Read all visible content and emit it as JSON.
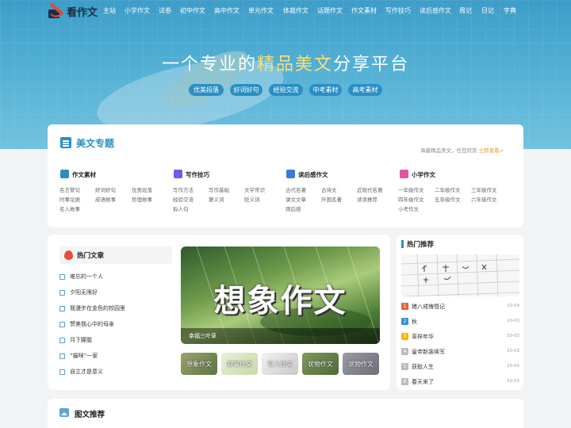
{
  "nav": {
    "logo_text": "看作文",
    "items": [
      "主站",
      "小学作文",
      "试卷",
      "初中作文",
      "高中作文",
      "单元作文",
      "体裁作文",
      "话题作文",
      "作文素材",
      "写作技巧",
      "读后感作文",
      "周记",
      "日记",
      "字典"
    ]
  },
  "hero": {
    "title_pre": "一个专业的",
    "title_highlight": "精品美文",
    "title_post": "分享平台",
    "tags": [
      "优美段落",
      "好词好句",
      "经验交流",
      "中考素材",
      "高考素材"
    ]
  },
  "topics": {
    "title": "美文专题",
    "slogan": "海量精品美文，任您欣赏",
    "more": "立即查看>",
    "columns": [
      {
        "title": "作文素材",
        "icon": "document-icon",
        "color": "#2a8fc4",
        "links": [
          "名言警句",
          "好词好句",
          "优美段落",
          "时事论据",
          "成语故事",
          "哲理故事",
          "名人故事"
        ]
      },
      {
        "title": "写作技巧",
        "icon": "pen-icon",
        "color": "#6c5ce7",
        "links": [
          "写作方法",
          "写作基础",
          "文学常识",
          "经验交流",
          "褒义词",
          "贬义词",
          "拟人句"
        ]
      },
      {
        "title": "读后感作文",
        "icon": "book-icon",
        "color": "#3a7bd5",
        "links": [
          "古代名著",
          "古诗文",
          "近现代名著",
          "课文文章",
          "外国名著",
          "读读推荐",
          "观后感"
        ]
      },
      {
        "title": "小学作文",
        "icon": "school-icon",
        "color": "#e056a0",
        "links": [
          "一年级作文",
          "二年级作文",
          "三年级作文",
          "四年级作文",
          "五年级作文",
          "六年级作文",
          "小考作文"
        ]
      }
    ]
  },
  "hot_articles": {
    "title": "热门文章",
    "items": [
      "难忘的一个人",
      "夕阳无限好",
      "我漫步在金色的校园里",
      "赞美我心中的母亲",
      "月下朦胧",
      "“猫咪”一家",
      "自立才是意义"
    ],
    "feature_title": "想象作文",
    "feature_caption": "幸福三叶草",
    "thumbs": [
      "想象作文",
      "叙事作文",
      "写人作文",
      "状物作文",
      "状物作文"
    ]
  },
  "recommend": {
    "title": "热门推荐",
    "items": [
      {
        "num": "1",
        "label": "猪八戒悔悟记",
        "date": "10-03",
        "color": "#e8643d"
      },
      {
        "num": "2",
        "label": "秋",
        "date": "10-03",
        "color": "#3a8fd6"
      },
      {
        "num": "3",
        "label": "草样年华",
        "date": "10-03",
        "color": "#f5b800"
      },
      {
        "num": "4",
        "label": "皇帝新装续写",
        "date": "10-03",
        "color": "#bbbbbb"
      },
      {
        "num": "5",
        "label": "获取人生",
        "date": "10-03",
        "color": "#bbbbbb"
      },
      {
        "num": "6",
        "label": "春天来了",
        "date": "10-03",
        "color": "#bbbbbb"
      }
    ]
  },
  "pictures": {
    "title": "图文推荐"
  }
}
